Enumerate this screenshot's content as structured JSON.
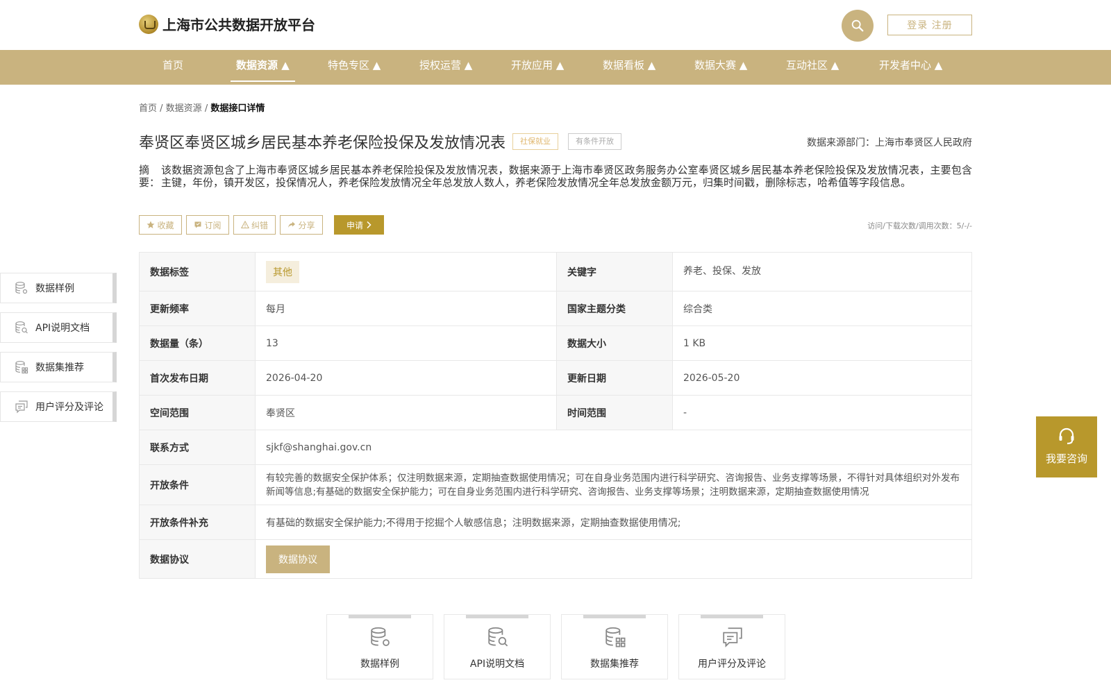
{
  "header": {
    "site_title": "上海市公共数据开放平台",
    "search_icon": "search-icon",
    "login_label": "登录 注册"
  },
  "nav": {
    "items": [
      {
        "label": "首页"
      },
      {
        "label": "数据资源 ▲",
        "active": true
      },
      {
        "label": "特色专区 ▲"
      },
      {
        "label": "授权运营 ▲"
      },
      {
        "label": "开放应用 ▲"
      },
      {
        "label": "数据看板 ▲"
      },
      {
        "label": "数据大赛 ▲"
      },
      {
        "label": "互动社区 ▲"
      },
      {
        "label": "开发者中心 ▲"
      }
    ]
  },
  "breadcrumb": {
    "home": "首页",
    "sep1": " / ",
    "section": "数据资源",
    "sep2": " / ",
    "current": "数据接口详情"
  },
  "dataset": {
    "title": "奉贤区奉贤区城乡居民基本养老保险投保及发放情况表",
    "tag_category": "社保就业",
    "tag_open": "有条件开放",
    "source": "数据来源部门：上海市奉贤区人民政府",
    "summary_label": "摘要：",
    "summary": "该数据资源包含了上海市奉贤区城乡居民基本养老保险投保及发放情况表，数据来源于上海市奉贤区政务服务办公室奉贤区城乡居民基本养老保险投保及发放情况表，主要包含主键，年份，镇开发区，投保情况人，养老保险发放情况全年总发放人数人，养老保险发放情况全年总发放金额万元，归集时间戳，删除标志，哈希值等字段信息。"
  },
  "actions": {
    "favorite": "收藏",
    "subscribe": "订阅",
    "report": "纠错",
    "share": "分享",
    "apply": "申请",
    "visits": "访问/下载次数/调用次数：5/-/-"
  },
  "side_nav": {
    "items": [
      {
        "label": "数据样例",
        "icon": "database-gear-icon"
      },
      {
        "label": "API说明文档",
        "icon": "database-search-icon"
      },
      {
        "label": "数据集推荐",
        "icon": "database-grid-icon"
      },
      {
        "label": "用户评分及评论",
        "icon": "comment-icon"
      }
    ]
  },
  "details": {
    "tag_key": "数据标签",
    "tag_val": "其他",
    "keyword_key": "关键字",
    "keyword_val": "养老、投保、发放",
    "freq_key": "更新频率",
    "freq_val": "每月",
    "theme_key": "国家主题分类",
    "theme_val": "综合类",
    "count_key": "数据量（条）",
    "count_val": "13",
    "size_key": "数据大小",
    "size_val": "1 KB",
    "first_key": "首次发布日期",
    "first_val": "2026-04-20",
    "updated_key": "更新日期",
    "updated_val": "2026-05-20",
    "space_key": "空间范围",
    "space_val": "奉贤区",
    "time_key": "时间范围",
    "time_val": "-",
    "contact_key": "联系方式",
    "contact_val": "sjkf@shanghai.gov.cn",
    "cond_key": "开放条件",
    "cond_val": "有较完善的数据安全保护体系；仅注明数据来源，定期抽查数据使用情况；可在自身业务范围内进行科学研究、咨询报告、业务支撑等场景，不得针对具体组织对外发布新闻等信息;有基础的数据安全保护能力；可在自身业务范围内进行科学研究、咨询报告、业务支撑等场景；注明数据来源，定期抽查数据使用情况",
    "cond_extra_key": "开放条件补充",
    "cond_extra_val": "有基础的数据安全保护能力;不得用于挖掘个人敏感信息；注明数据来源，定期抽查数据使用情况;",
    "agreement_key": "数据协议",
    "agreement_btn": "数据协议"
  },
  "bottom_cards": {
    "items": [
      {
        "label": "数据样例"
      },
      {
        "label": "API说明文档"
      },
      {
        "label": "数据集推荐"
      },
      {
        "label": "用户评分及评论"
      }
    ]
  },
  "consult": {
    "label": "我要咨询",
    "icon": "headset-icon"
  },
  "colors": {
    "brand": "#c9b37f",
    "brand_dark": "#b8982c"
  }
}
